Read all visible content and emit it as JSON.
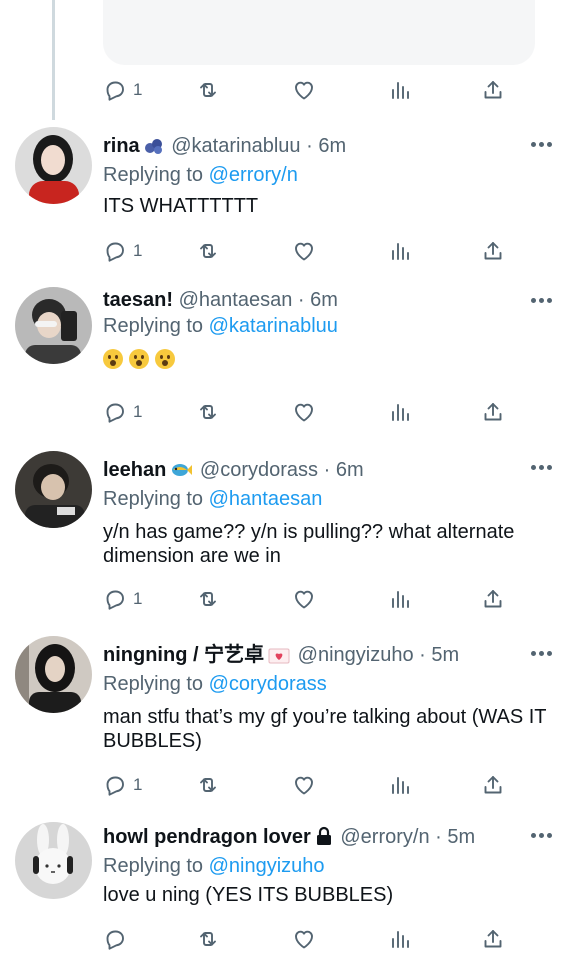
{
  "top_action_bar": {
    "reply_count": "1"
  },
  "tweets": [
    {
      "name": "rina",
      "name_emoji": "blueberries-icon",
      "handle": "@katarinabluu",
      "sep": "·",
      "time": "6m",
      "replying_prefix": "Replying to",
      "replying_to": "@errory/n",
      "text": "ITS WHATTTTTT",
      "reply_count": "1"
    },
    {
      "name": "taesan!",
      "handle": "@hantaesan",
      "sep": "·",
      "time": "6m",
      "replying_prefix": "Replying to",
      "replying_to": "@katarinabluu",
      "emojis": [
        "astonished-face-icon",
        "astonished-face-icon",
        "astonished-face-icon"
      ],
      "reply_count": "1"
    },
    {
      "name": "leehan",
      "name_emoji": "tropical-fish-icon",
      "handle": "@corydorass",
      "sep": "·",
      "time": "6m",
      "replying_prefix": "Replying to",
      "replying_to": "@hantaesan",
      "text": "y/n has game?? y/n is pulling?? what alternate dimension are we in",
      "reply_count": "1"
    },
    {
      "name": "ningning / 宁艺卓",
      "name_emoji": "love-letter-icon",
      "handle": "@ningyizuho",
      "sep": "·",
      "time": "5m",
      "replying_prefix": "Replying to",
      "replying_to": "@corydorass",
      "text": "man stfu that’s my gf you’re talking about (WAS IT BUBBLES)",
      "reply_count": "1"
    },
    {
      "name": "howl pendragon lover",
      "name_emoji": "lock-icon",
      "handle": "@errory/n",
      "sep": "·",
      "time": "5m",
      "replying_prefix": "Replying to",
      "replying_to": "@ningyizuho",
      "text": "love u ning (YES ITS BUBBLES)",
      "reply_count": ""
    }
  ],
  "colors": {
    "link": "#1d9bf0",
    "muted": "#536471",
    "text": "#0f1419"
  }
}
